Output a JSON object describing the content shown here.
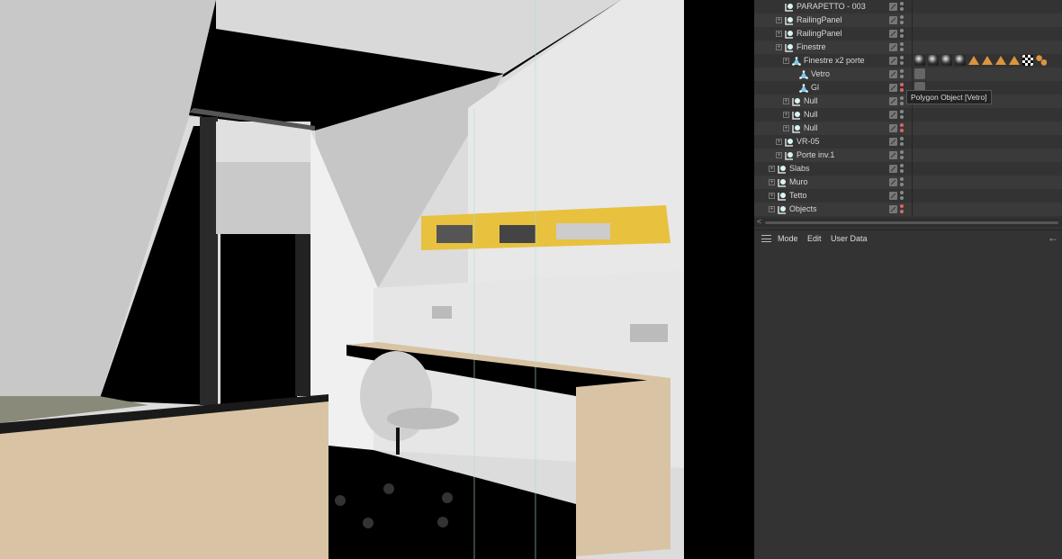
{
  "object_manager": {
    "rows": [
      {
        "name": "PARAPETTO - 003",
        "depth": 2,
        "icon": "null",
        "expand": false,
        "red": false
      },
      {
        "name": "RailingPanel",
        "depth": 2,
        "icon": "null",
        "expand": true,
        "red": false
      },
      {
        "name": "RailingPanel",
        "depth": 2,
        "icon": "null",
        "expand": true,
        "red": false
      },
      {
        "name": "Finestre",
        "depth": 2,
        "icon": "null",
        "expand": true,
        "red": false
      },
      {
        "name": "Finestre x2 porte",
        "depth": 3,
        "icon": "polygon",
        "expand": true,
        "red": false
      },
      {
        "name": "Vetro",
        "depth": 4,
        "icon": "polygon",
        "expand": false,
        "red": false
      },
      {
        "name": "Gl",
        "depth": 4,
        "icon": "polygon",
        "expand": false,
        "red": true
      },
      {
        "name": "Null",
        "depth": 3,
        "icon": "null",
        "expand": true,
        "red": false
      },
      {
        "name": "Null",
        "depth": 3,
        "icon": "null",
        "expand": true,
        "red": false
      },
      {
        "name": "Null",
        "depth": 3,
        "icon": "null",
        "expand": true,
        "red": true
      },
      {
        "name": "VR-05",
        "depth": 2,
        "icon": "null",
        "expand": true,
        "red": false
      },
      {
        "name": "Porte inv.1",
        "depth": 2,
        "icon": "null",
        "expand": true,
        "red": false
      },
      {
        "name": "Slabs",
        "depth": 1,
        "icon": "null",
        "expand": true,
        "red": false
      },
      {
        "name": "Muro",
        "depth": 1,
        "icon": "null",
        "expand": true,
        "red": false
      },
      {
        "name": "Tetto",
        "depth": 1,
        "icon": "null",
        "expand": true,
        "red": false
      },
      {
        "name": "Objects",
        "depth": 1,
        "icon": "null",
        "expand": true,
        "red": true
      }
    ],
    "tooltip": "Polygon Object [Vetro]"
  },
  "attributes": {
    "menu": [
      "Mode",
      "Edit",
      "User Data"
    ]
  },
  "colors": {
    "accent_yellow": "#e8c13f",
    "wood": "#d9c3a5",
    "tag_orange": "#d9953f"
  }
}
